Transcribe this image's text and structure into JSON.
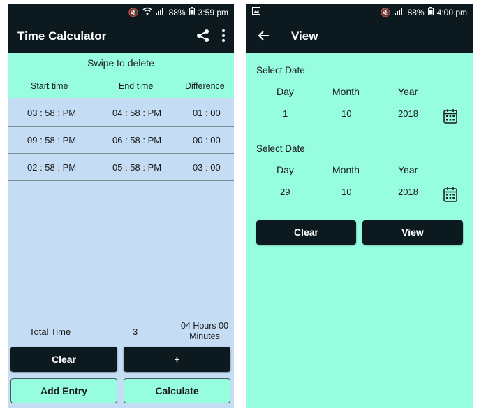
{
  "left": {
    "status": {
      "battery": "88%",
      "time": "3:59 pm"
    },
    "title": "Time Calculator",
    "hint": "Swipe to delete",
    "headers": [
      "Start time",
      "End time",
      "Difference"
    ],
    "rows": [
      {
        "start": "03 : 58 : PM",
        "end": "04 : 58 : PM",
        "diff": "01 : 00"
      },
      {
        "start": "09 : 58 : PM",
        "end": "06 : 58 : PM",
        "diff": "00 : 00"
      },
      {
        "start": "02 : 58 : PM",
        "end": "05 : 58 : PM",
        "diff": "03 : 00"
      }
    ],
    "total": {
      "label": "Total Time",
      "count": "3",
      "value_line1": "04 Hours 00",
      "value_line2": "Minutes"
    },
    "buttons": {
      "clear": "Clear",
      "add": "+",
      "add_entry": "Add Entry",
      "calculate": "Calculate"
    }
  },
  "right": {
    "status": {
      "battery": "88%",
      "time": "4:00 pm"
    },
    "title": "View",
    "dates": [
      {
        "label": "Select Date",
        "day_header": "Day",
        "month_header": "Month",
        "year_header": "Year",
        "day": "1",
        "month": "10",
        "year": "2018"
      },
      {
        "label": "Select Date",
        "day_header": "Day",
        "month_header": "Month",
        "year_header": "Year",
        "day": "29",
        "month": "10",
        "year": "2018"
      }
    ],
    "buttons": {
      "clear": "Clear",
      "view": "View"
    }
  },
  "colors": {
    "appbar": "#0c1a1f",
    "mint": "#96fedf",
    "list_bg": "#c4dcf4"
  }
}
